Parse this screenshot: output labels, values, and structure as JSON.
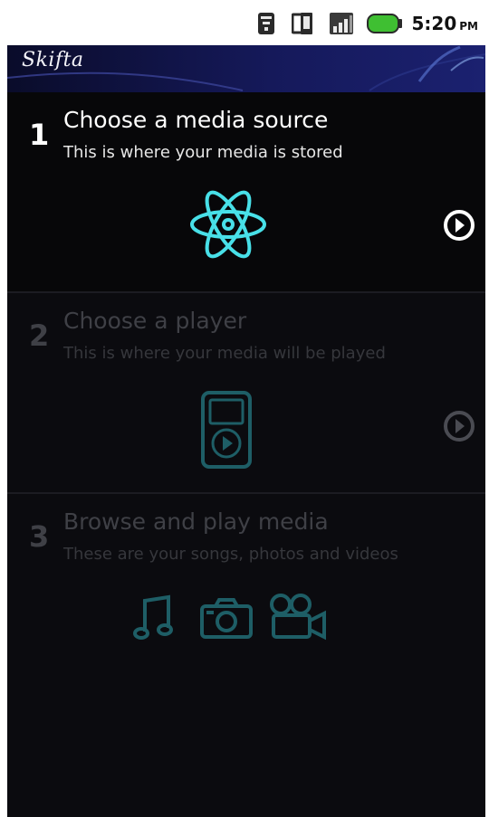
{
  "status_bar": {
    "time": "5:20",
    "ampm": "PM",
    "icons": [
      "wifi-icon",
      "phone-sync-icon",
      "signal-icon",
      "battery-icon"
    ]
  },
  "header": {
    "logo_text": "Skifta",
    "brand_color": "#15195a"
  },
  "steps": [
    {
      "number": "1",
      "title": "Choose a media source",
      "subtitle": "This is where your media is stored",
      "icon": "atom-icon",
      "state": "active"
    },
    {
      "number": "2",
      "title": "Choose a player",
      "subtitle": "This is where your media will be played",
      "icon": "media-player-icon",
      "state": "disabled"
    },
    {
      "number": "3",
      "title": "Browse and play media",
      "subtitle": "These are your songs, photos and videos",
      "icons": [
        "music-note-icon",
        "camera-icon",
        "video-camera-icon"
      ],
      "state": "disabled"
    }
  ],
  "colors": {
    "accent_glow": "#48e0e8",
    "background": "#0b0b0d",
    "active_text": "#ffffff",
    "disabled_text": "#3f4046"
  }
}
